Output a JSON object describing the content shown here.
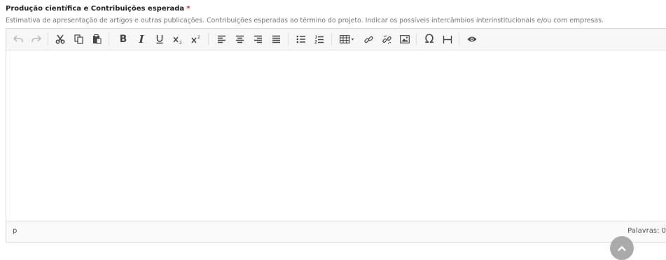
{
  "field": {
    "title": "Produção científica e Contribuições esperada",
    "required_mark": "*",
    "help": "Estimativa de apresentação de artigos e outras publicações. Contribuições esperadas ao término do projeto. Indicar os possíveis intercâmbios interinstitucionais e/ou com empresas."
  },
  "toolbar": {
    "bold_glyph": "B",
    "italic_glyph": "I",
    "special_char_glyph": "Ω"
  },
  "editor": {
    "content": ""
  },
  "statusbar": {
    "path": "p",
    "wordcount": "Palavras: 0"
  },
  "icons": [
    "undo-icon",
    "redo-icon",
    "cut-icon",
    "copy-icon",
    "paste-icon",
    "bold-icon",
    "italic-icon",
    "underline-icon",
    "subscript-icon",
    "superscript-icon",
    "align-left-icon",
    "align-center-icon",
    "align-right-icon",
    "align-justify-icon",
    "bullet-list-icon",
    "numbered-list-icon",
    "table-icon",
    "link-icon",
    "unlink-icon",
    "image-icon",
    "special-char-icon",
    "horizontal-rule-icon",
    "preview-icon",
    "chevron-up-icon"
  ]
}
